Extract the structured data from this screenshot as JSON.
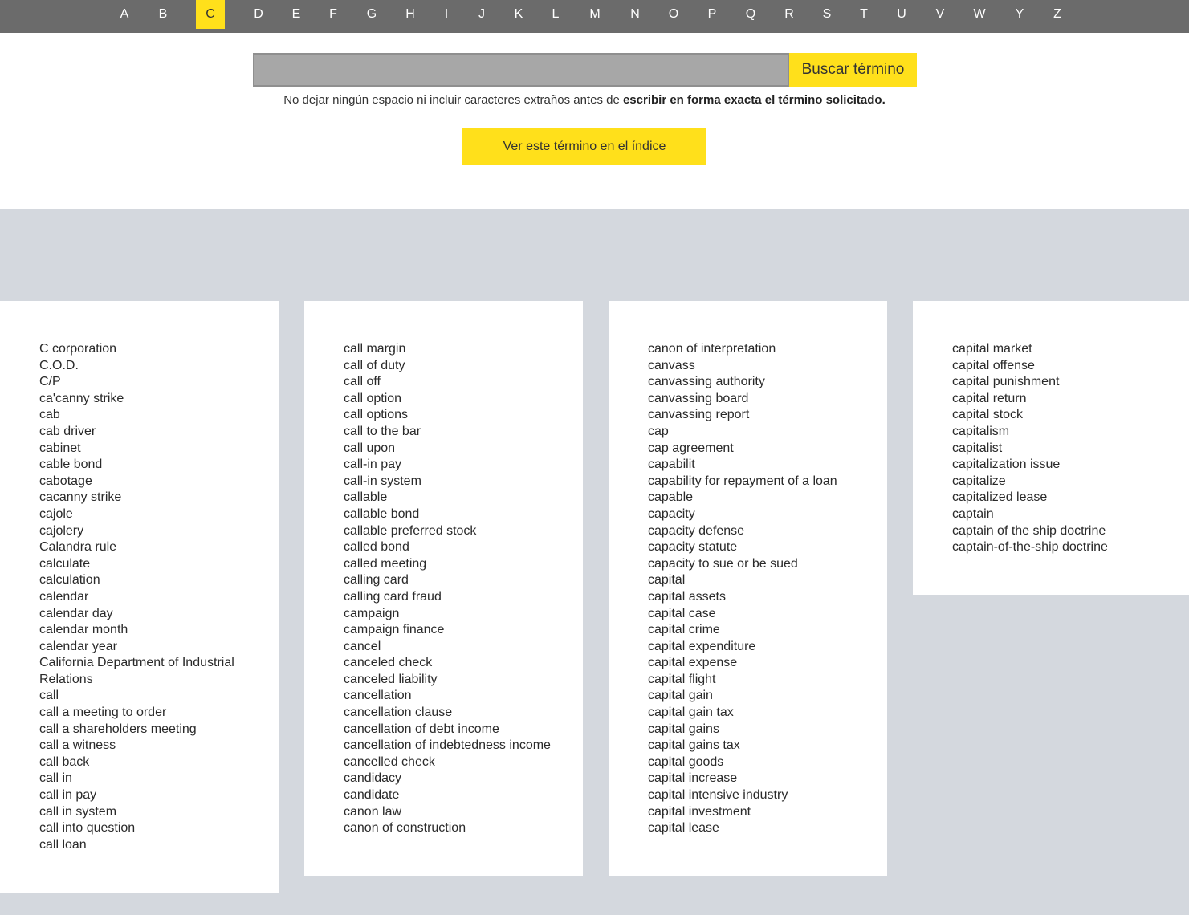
{
  "alphabet": {
    "letters": [
      "A",
      "B",
      "C",
      "D",
      "E",
      "F",
      "G",
      "H",
      "I",
      "J",
      "K",
      "L",
      "M",
      "N",
      "O",
      "P",
      "Q",
      "R",
      "S",
      "T",
      "U",
      "V",
      "W",
      "Y",
      "Z"
    ],
    "active": "C"
  },
  "search": {
    "value": "",
    "placeholder": "",
    "button_label": "Buscar término",
    "hint_normal": "No dejar ningún espacio ni incluir caracteres extraños antes de ",
    "hint_bold": "escribir en forma exacta el término solicitado."
  },
  "index_button_label": "Ver este término en el índice",
  "colors": {
    "accent": "#ffe01b",
    "nav_bar": "#6b6b6b",
    "panel_bg": "#d4d8de",
    "input_bg": "#a7a7a7"
  },
  "columns": [
    [
      "C corporation",
      "C.O.D.",
      "C/P",
      "ca'canny strike",
      "cab",
      "cab driver",
      "cabinet",
      "cable bond",
      "cabotage",
      "cacanny strike",
      "cajole",
      "cajolery",
      "Calandra rule",
      "calculate",
      "calculation",
      "calendar",
      "calendar day",
      "calendar month",
      "calendar year",
      "California Department of Industrial Relations",
      "call",
      "call a meeting to order",
      "call a shareholders meeting",
      "call a witness",
      "call back",
      "call in",
      "call in pay",
      "call in system",
      "call into question",
      "call loan"
    ],
    [
      "call margin",
      "call of duty",
      "call off",
      "call option",
      "call options",
      "call to the bar",
      "call upon",
      "call-in pay",
      "call-in system",
      "callable",
      "callable bond",
      "callable preferred stock",
      "called bond",
      "called meeting",
      "calling card",
      "calling card fraud",
      "campaign",
      "campaign finance",
      "cancel",
      "canceled check",
      "canceled liability",
      "cancellation",
      "cancellation clause",
      "cancellation of debt income",
      "cancellation of indebtedness income",
      "cancelled check",
      "candidacy",
      "candidate",
      "canon law",
      "canon of construction"
    ],
    [
      "canon of interpretation",
      "canvass",
      "canvassing authority",
      "canvassing board",
      "canvassing report",
      "cap",
      "cap agreement",
      "capabilit",
      "capability for repayment of a loan",
      "capable",
      "capacity",
      "capacity defense",
      "capacity statute",
      "capacity to sue or be sued",
      "capital",
      "capital assets",
      "capital case",
      "capital crime",
      "capital expenditure",
      "capital expense",
      "capital flight",
      "capital gain",
      "capital gain tax",
      "capital gains",
      "capital gains tax",
      "capital goods",
      "capital increase",
      "capital intensive industry",
      "capital investment",
      "capital lease"
    ],
    [
      "capital market",
      "capital offense",
      "capital punishment",
      "capital return",
      "capital stock",
      "capitalism",
      "capitalist",
      "capitalization issue",
      "capitalize",
      "capitalized lease",
      "captain",
      "captain of the ship doctrine",
      "captain-of-the-ship doctrine"
    ]
  ]
}
